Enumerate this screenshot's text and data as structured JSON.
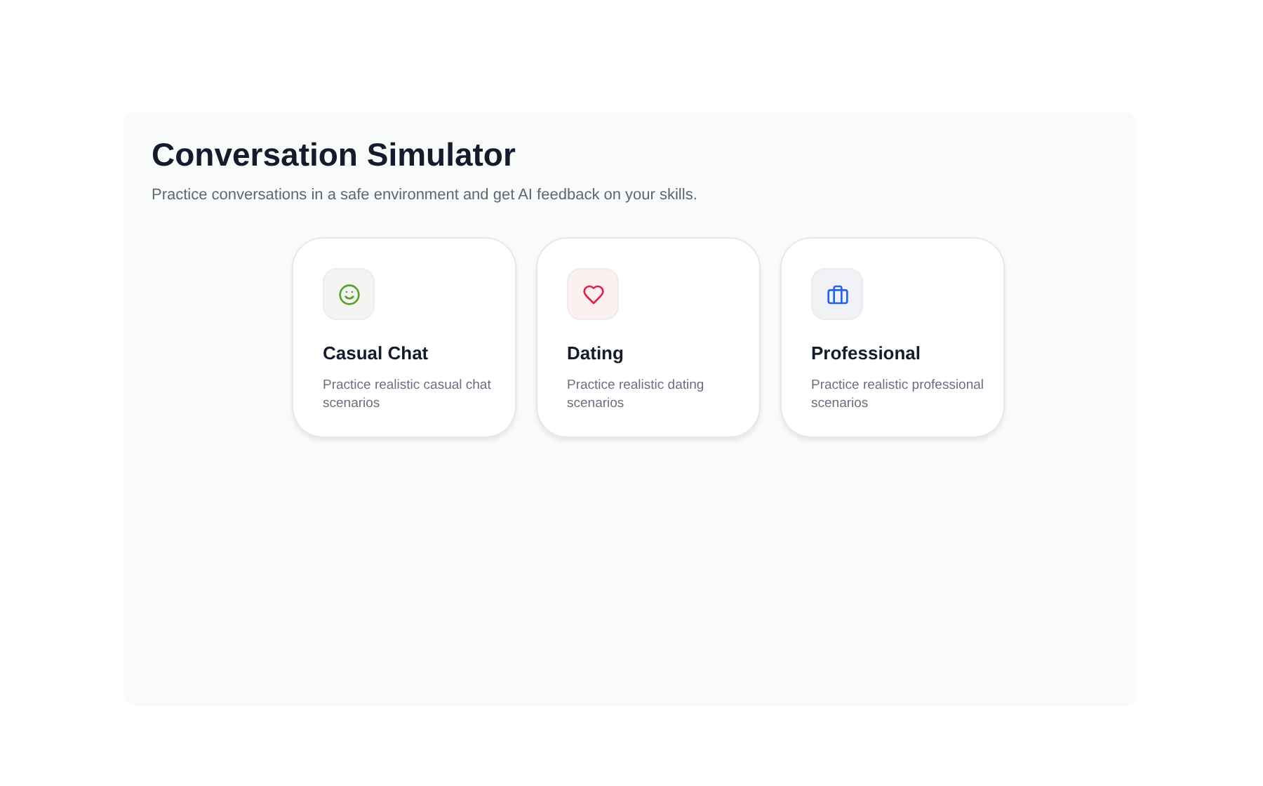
{
  "header": {
    "title": "Conversation Simulator",
    "subtitle": "Practice conversations in a safe environment and get AI feedback on your skills."
  },
  "modes": [
    {
      "kind": "smile",
      "title": "Casual Chat",
      "description": "Practice realistic casual chat scenarios"
    },
    {
      "kind": "heart",
      "title": "Dating",
      "description": "Practice realistic dating scenarios"
    },
    {
      "kind": "briefcase",
      "title": "Professional",
      "description": "Practice realistic professional scenarios"
    }
  ]
}
